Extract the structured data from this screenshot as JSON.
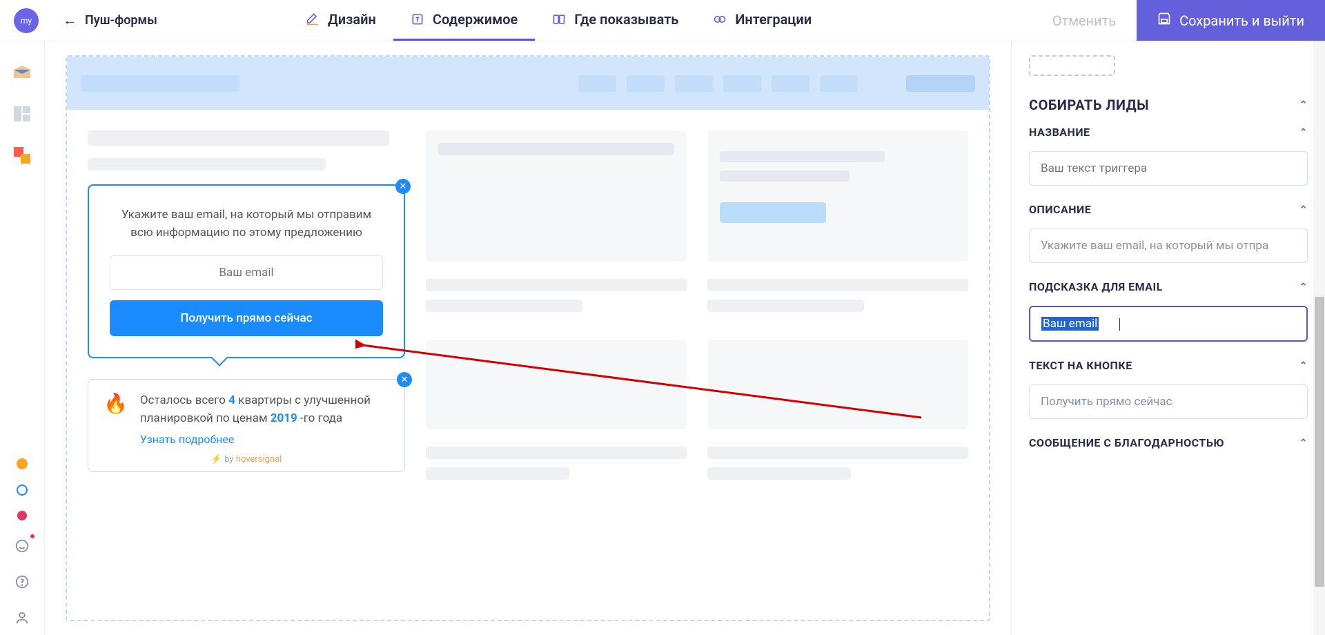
{
  "avatar": "my",
  "breadcrumb": "Пуш-формы",
  "tabs": {
    "design": "Дизайн",
    "content": "Содержимое",
    "where": "Где показывать",
    "integrations": "Интеграции"
  },
  "actions": {
    "cancel": "Отменить",
    "save": "Сохранить и выйти"
  },
  "popup": {
    "text": "Укажите ваш email, на который мы отправим всю информацию по этому предложению",
    "placeholder": "Ваш email",
    "button": "Получить прямо сейчас"
  },
  "notif": {
    "pre": "Осталось всего ",
    "num1": "4",
    "mid1": " квартиры с улучшенной планировкой по ценам ",
    "num2": "2019",
    "mid2": " -го года",
    "link": "Узнать подробнее",
    "by": " by ",
    "brand": "hoversignal"
  },
  "sidebar": {
    "collect": "СОБИРАТЬ ЛИДЫ",
    "name_label": "НАЗВАНИЕ",
    "name_placeholder": "Ваш текст триггера",
    "desc_label": "ОПИСАНИЕ",
    "desc_value": "Укажите ваш email, на который мы отпра",
    "hint_label": "ПОДСКАЗКА ДЛЯ EMAIL",
    "hint_value": "Ваш email",
    "btn_label": "ТЕКСТ НА КНОПКЕ",
    "btn_value": "Получить прямо сейчас",
    "thanks_label": "СООБЩЕНИЕ С БЛАГОДАРНОСТЬЮ"
  }
}
